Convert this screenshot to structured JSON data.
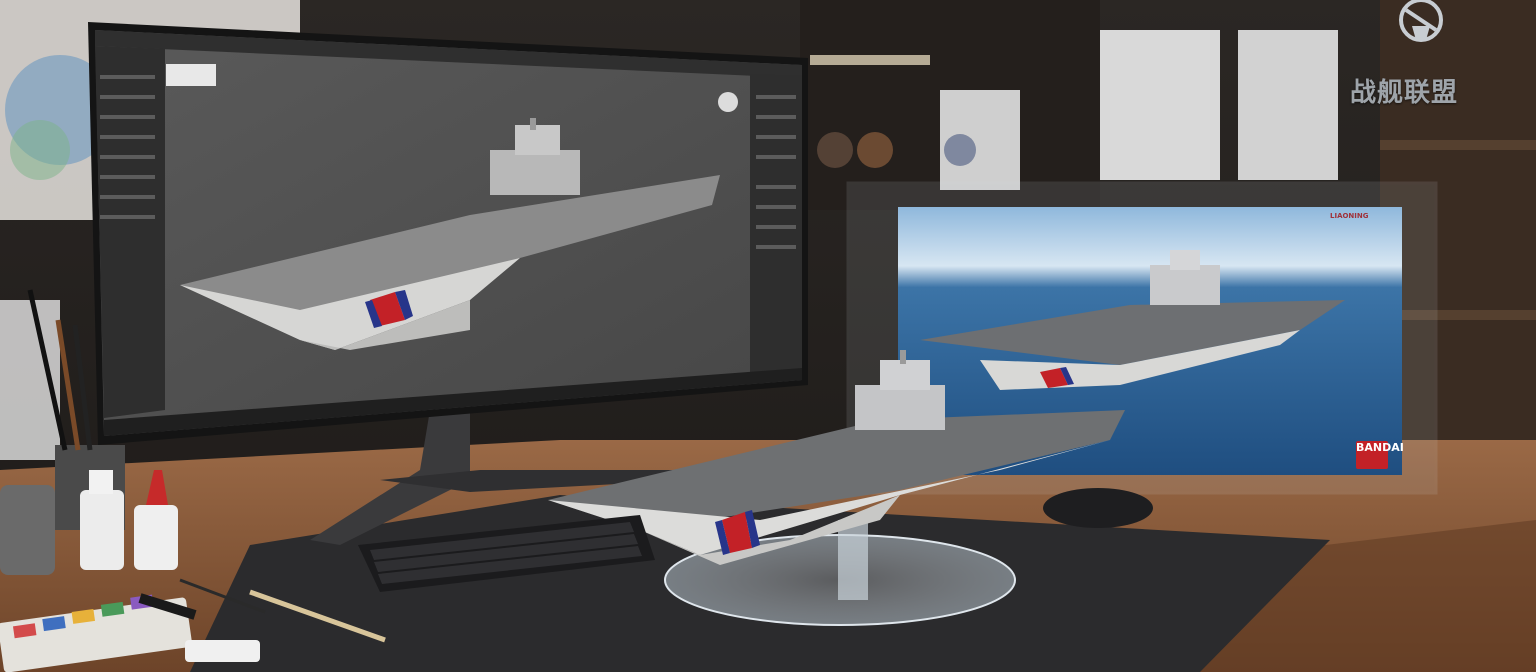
{
  "watermark": {
    "logo_text": "战舰联盟",
    "logo_icon": "warship-emblem-icon"
  },
  "monitor": {
    "application": "3d-modeling-software",
    "subject": "aircraft-carrier-model"
  },
  "poster": {
    "title": "LIAONING",
    "brand": "BANDAI"
  },
  "colors": {
    "desk_wood": "#8a5a3c",
    "mat": "#2b2b2d",
    "ocean": "#2d5f93",
    "carrier_hull": "#d9d9d6",
    "stripe_red": "#c32127",
    "stripe_blue": "#27358a"
  }
}
